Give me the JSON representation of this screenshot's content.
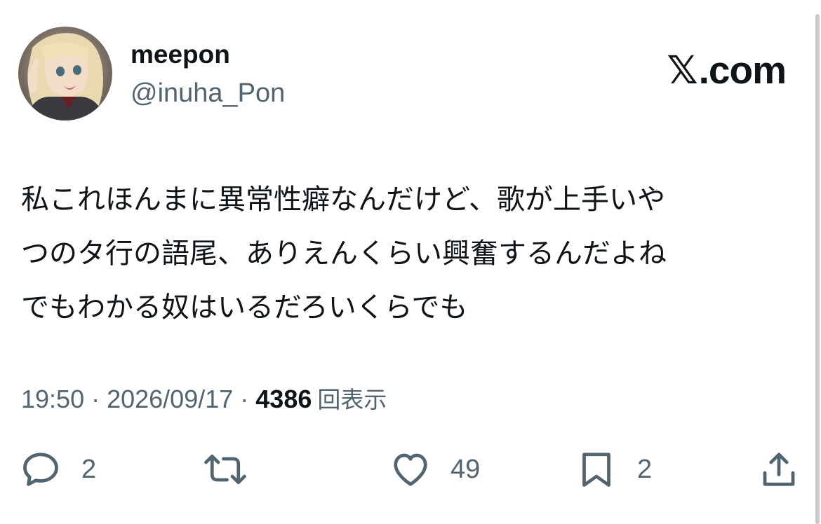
{
  "user": {
    "display_name": "meepon",
    "handle": "@inuha_Pon",
    "avatar_icon": "anime-girl-avatar"
  },
  "brand": {
    "x_glyph": "𝕏",
    "domain": ".com"
  },
  "tweet": {
    "lines": [
      "私これほんまに異常性癖なんだけど、歌が上手いや",
      "つのタ行の語尾、ありえんくらい興奮するんだよね",
      "でもわかる奴はいるだろいくらでも"
    ]
  },
  "meta": {
    "time": "19:50",
    "date": "2026/09/17",
    "separator": "·",
    "view_count": "4386",
    "view_label": "回表示"
  },
  "actions": {
    "reply_count": "2",
    "retweet_count": "",
    "like_count": "49",
    "bookmark_count": "2"
  },
  "colors": {
    "text_primary": "#0f1419",
    "text_secondary": "#536471"
  }
}
